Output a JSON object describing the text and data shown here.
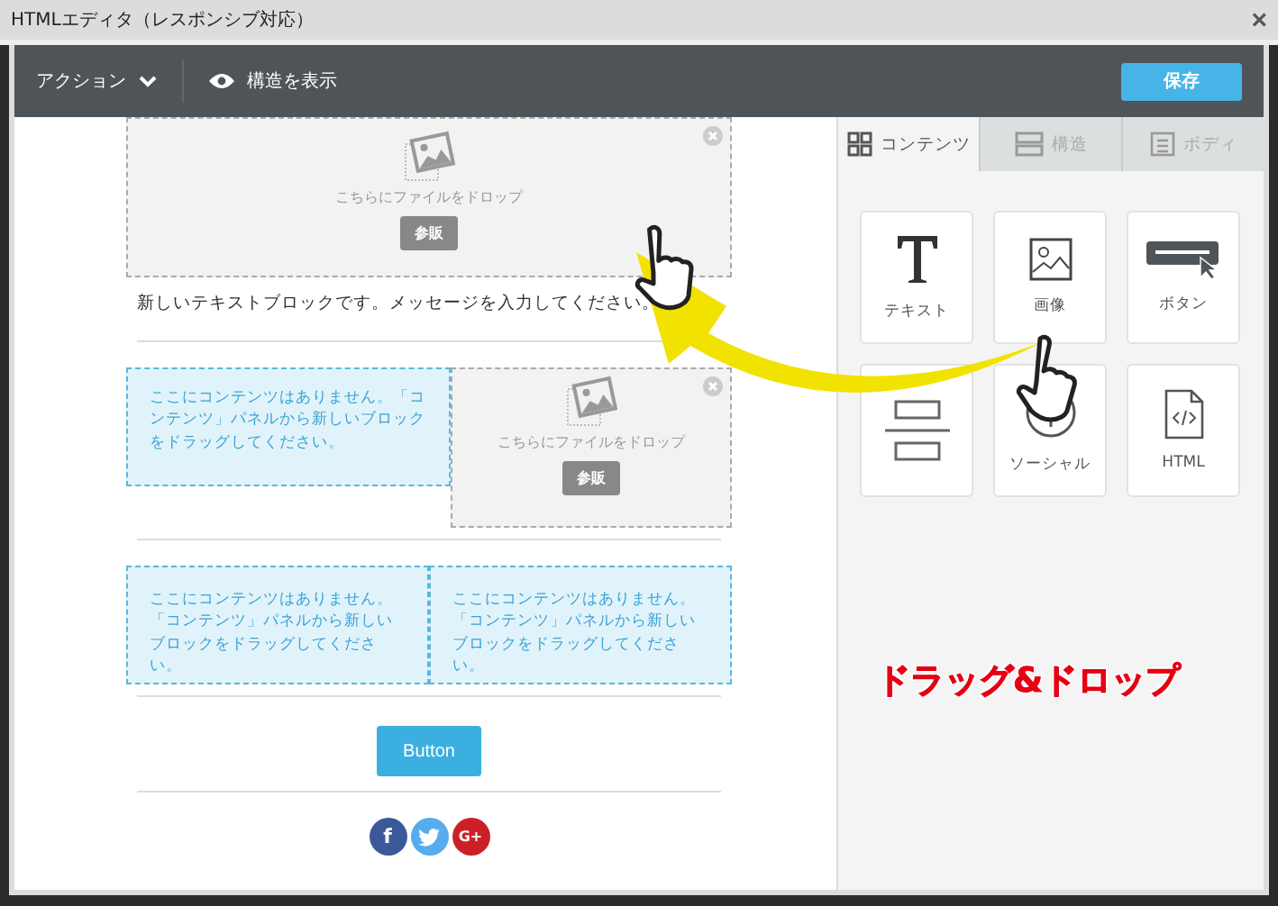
{
  "window": {
    "title": "HTMLエディタ（レスポンシブ対応）",
    "close": "×"
  },
  "toolbar": {
    "action": "アクション",
    "show_structure": "構造を表示",
    "save": "保存"
  },
  "canvas": {
    "image_block": {
      "drop_text": "こちらにファイルをドロップ",
      "browse": "参販"
    },
    "text_block": "新しいテキストブロックです。メッセージを入力してください。",
    "row1": [
      {
        "kind": "empty",
        "text": "ここにコンテンツはありません。「コンテンツ」パネルから新しいブロックをドラッグしてください。"
      },
      {
        "kind": "image",
        "drop_text": "こちらにファイルをドロップ",
        "browse": "参販"
      }
    ],
    "row2": [
      {
        "kind": "empty",
        "text": "ここにコンテンツはありません。「コンテンツ」パネルから新しいブロックをドラッグしてください。"
      },
      {
        "kind": "empty",
        "text": "ここにコンテンツはありません。「コンテンツ」パネルから新しいブロックをドラッグしてください。"
      }
    ],
    "button": "Button",
    "social": [
      {
        "kind": "facebook",
        "label": "f",
        "color": "#3b5998"
      },
      {
        "kind": "twitter",
        "color": "#55acee"
      },
      {
        "kind": "google",
        "label": "G+",
        "color": "#cc2027"
      }
    ]
  },
  "panel": {
    "tabs": [
      {
        "label": "コンテンツ",
        "kind": "grid",
        "selected": true
      },
      {
        "label": "構造",
        "kind": "rows",
        "selected": false
      },
      {
        "label": "ボディ",
        "kind": "page",
        "selected": false
      }
    ],
    "blocks": [
      {
        "kind": "text",
        "label": "テキスト"
      },
      {
        "kind": "image",
        "label": "画像"
      },
      {
        "kind": "button",
        "label": "ボタン"
      },
      {
        "kind": "spacer"
      },
      {
        "kind": "social",
        "label": "ソーシャル"
      },
      {
        "kind": "html",
        "label": "HTML"
      }
    ]
  },
  "annotation": "ドラッグ&ドロップ"
}
